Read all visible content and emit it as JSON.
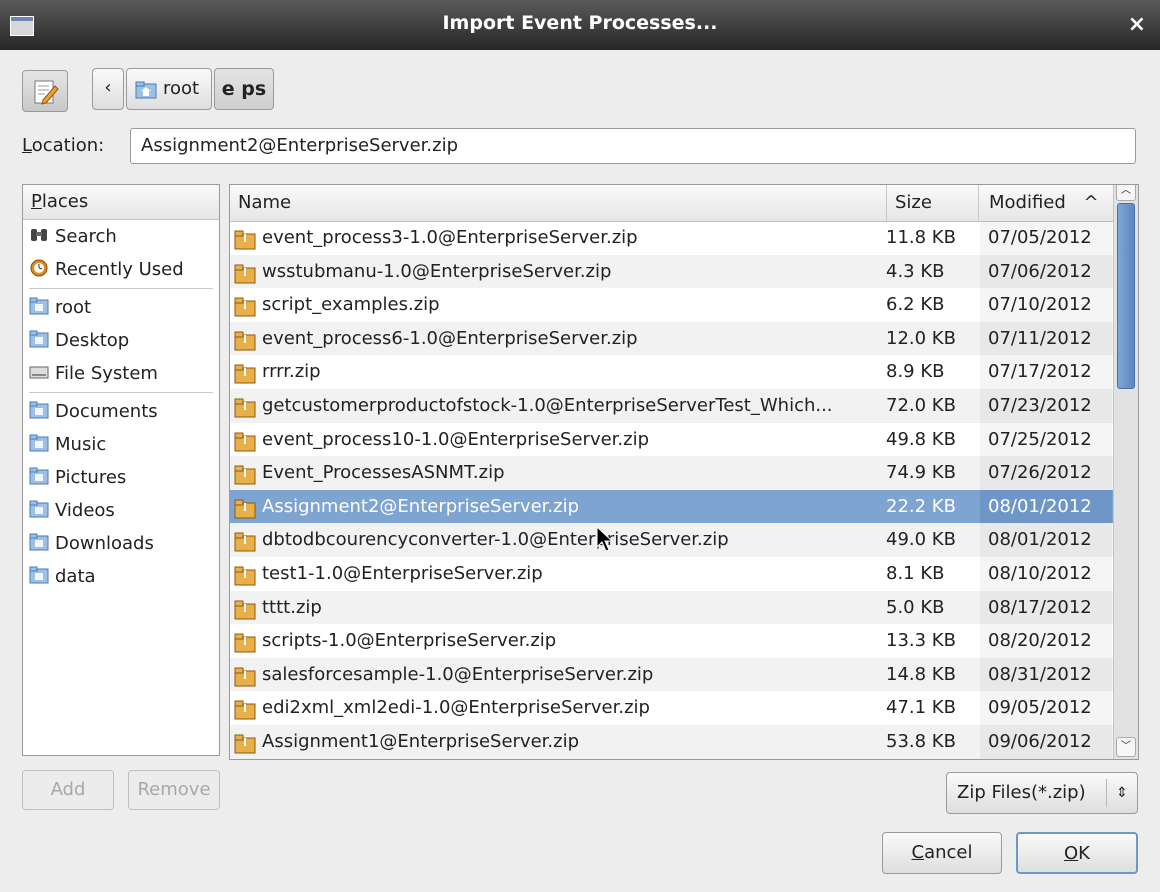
{
  "window": {
    "title": "Import Event Processes...",
    "close_glyph": "×"
  },
  "toolbar": {
    "edit_icon": "pencil-edit-icon",
    "back_label": "‹",
    "path": [
      "root",
      "e ps"
    ]
  },
  "location": {
    "label": "Location:",
    "label_mnemonic": "L",
    "value": "Assignment2@EnterpriseServer.zip"
  },
  "places": {
    "header": "Places",
    "items": [
      {
        "label": "Search",
        "icon": "binoculars-icon"
      },
      {
        "label": "Recently Used",
        "icon": "recent-icon"
      },
      {
        "label": "root",
        "icon": "home-folder-icon"
      },
      {
        "label": "Desktop",
        "icon": "desktop-folder-icon"
      },
      {
        "label": "File System",
        "icon": "drive-icon"
      },
      {
        "label": "Documents",
        "icon": "documents-folder-icon"
      },
      {
        "label": "Music",
        "icon": "music-folder-icon"
      },
      {
        "label": "Pictures",
        "icon": "pictures-folder-icon"
      },
      {
        "label": "Videos",
        "icon": "videos-folder-icon"
      },
      {
        "label": "Downloads",
        "icon": "downloads-folder-icon"
      },
      {
        "label": "data",
        "icon": "folder-icon"
      }
    ]
  },
  "files": {
    "columns": {
      "name": "Name",
      "size": "Size",
      "modified": "Modified",
      "sort_glyph": "^"
    },
    "rows": [
      {
        "name": "event_process3-1.0@EnterpriseServer.zip",
        "size": "11.8 KB",
        "modified": "07/05/2012"
      },
      {
        "name": "wsstubmanu-1.0@EnterpriseServer.zip",
        "size": "4.3 KB",
        "modified": "07/06/2012"
      },
      {
        "name": "script_examples.zip",
        "size": "6.2 KB",
        "modified": "07/10/2012"
      },
      {
        "name": "event_process6-1.0@EnterpriseServer.zip",
        "size": "12.0 KB",
        "modified": "07/11/2012"
      },
      {
        "name": "rrrr.zip",
        "size": "8.9 KB",
        "modified": "07/17/2012"
      },
      {
        "name": "getcustomerproductofstock-1.0@EnterpriseServerTest_Which...",
        "size": "72.0 KB",
        "modified": "07/23/2012"
      },
      {
        "name": "event_process10-1.0@EnterpriseServer.zip",
        "size": "49.8 KB",
        "modified": "07/25/2012"
      },
      {
        "name": "Event_ProcessesASNMT.zip",
        "size": "74.9 KB",
        "modified": "07/26/2012"
      },
      {
        "name": "Assignment2@EnterpriseServer.zip",
        "size": "22.2 KB",
        "modified": "08/01/2012",
        "selected": true
      },
      {
        "name": "dbtodbcourencyconverter-1.0@EnterpriseServer.zip",
        "size": "49.0 KB",
        "modified": "08/01/2012"
      },
      {
        "name": "test1-1.0@EnterpriseServer.zip",
        "size": "8.1 KB",
        "modified": "08/10/2012"
      },
      {
        "name": "tttt.zip",
        "size": "5.0 KB",
        "modified": "08/17/2012"
      },
      {
        "name": "scripts-1.0@EnterpriseServer.zip",
        "size": "13.3 KB",
        "modified": "08/20/2012"
      },
      {
        "name": "salesforcesample-1.0@EnterpriseServer.zip",
        "size": "14.8 KB",
        "modified": "08/31/2012"
      },
      {
        "name": "edi2xml_xml2edi-1.0@EnterpriseServer.zip",
        "size": "47.1 KB",
        "modified": "09/05/2012"
      },
      {
        "name": "Assignment1@EnterpriseServer.zip",
        "size": "53.8 KB",
        "modified": "09/06/2012"
      }
    ]
  },
  "buttons": {
    "add": "Add",
    "remove": "Remove",
    "cancel": "Cancel",
    "ok": "OK"
  },
  "filter": {
    "value": "Zip Files(*.zip)",
    "arrow_glyph": "⇕"
  },
  "colors": {
    "selection": "#7ea4d2",
    "titlebar": "#3a3a3a",
    "dialog_bg": "#ededed"
  }
}
